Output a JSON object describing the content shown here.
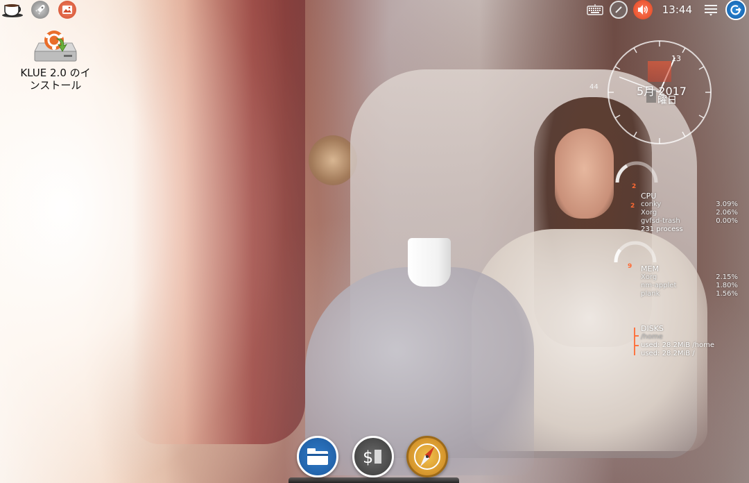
{
  "top_panel": {
    "launchers": [
      {
        "name": "coffee-icon"
      },
      {
        "name": "rocket-icon"
      },
      {
        "name": "image-viewer-icon"
      }
    ],
    "tray": {
      "clock_time": "13:44"
    }
  },
  "desktop_icons": [
    {
      "label": "KLUE 2.0 のイ\nンストール",
      "icon": "ubuntu-installer-icon"
    }
  ],
  "conky": {
    "clock": {
      "month_year": "5月 2017",
      "weekday": "曜日",
      "seconds": "44",
      "minutes": "13"
    },
    "cpu": {
      "title": "CPU",
      "processes": [
        {
          "name": "conky",
          "value": "3.09%"
        },
        {
          "name": "Xorg",
          "value": "2.06%"
        },
        {
          "name": "gvfsd-trash",
          "value": "0.00%"
        }
      ],
      "footer": "231 process",
      "marks": [
        "2",
        "2"
      ]
    },
    "mem": {
      "title": "MEM",
      "processes": [
        {
          "name": "Xorg",
          "value": "2.15%"
        },
        {
          "name": "nm-applet",
          "value": "1.80%"
        },
        {
          "name": "plank",
          "value": "1.56%"
        }
      ],
      "marks": [
        "9"
      ]
    },
    "disks": {
      "title": "DISKS",
      "subtitle": "/home",
      "rows": [
        "used: 28.2MiB /home",
        "used: 28.2MiB /"
      ]
    }
  },
  "dock": {
    "items": [
      {
        "name": "files"
      },
      {
        "name": "terminal"
      },
      {
        "name": "web-browser"
      }
    ]
  },
  "colors": {
    "accent_orange": "#e0451f",
    "accent_blue": "#1d5a9e"
  }
}
